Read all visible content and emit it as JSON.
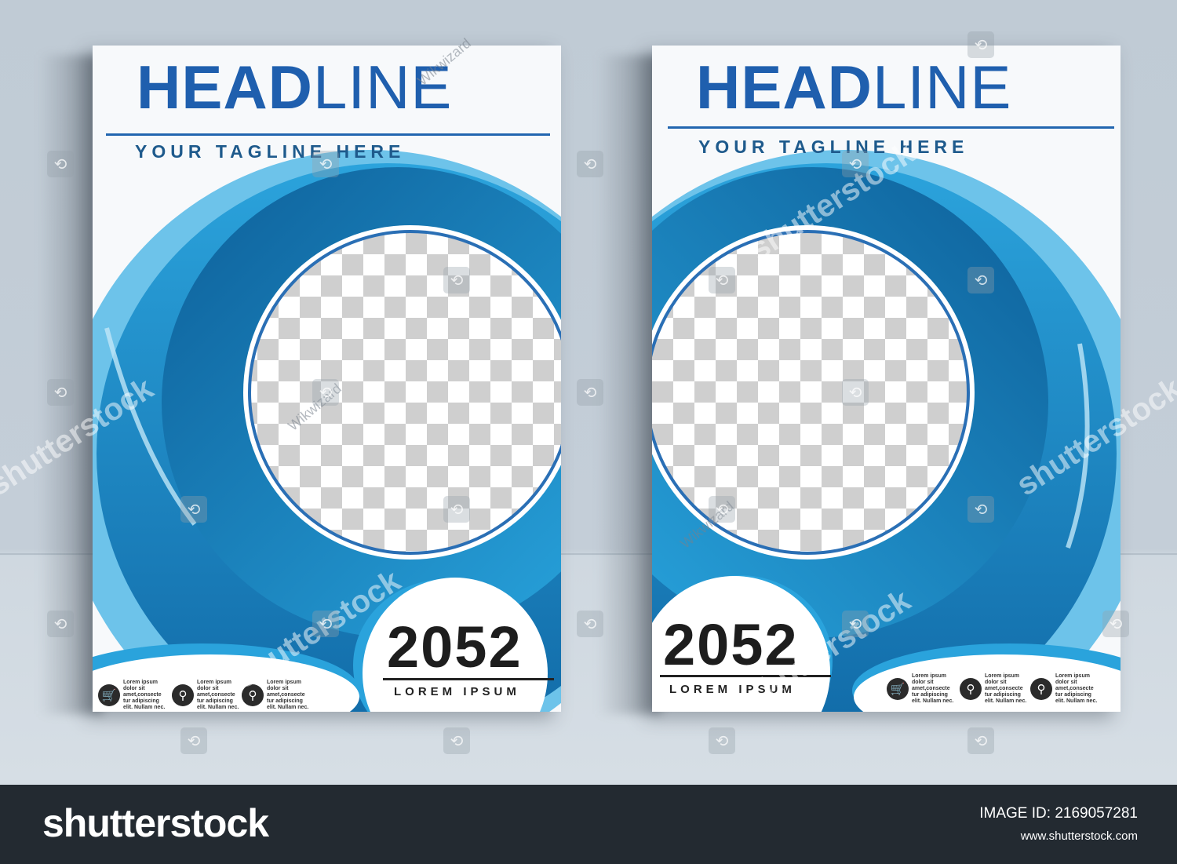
{
  "posters": [
    {
      "headline_bold": "HEAD",
      "headline_light": "LINE",
      "tagline": "YOUR TAGLINE HERE",
      "year": "2052",
      "subtitle": "LOREM IPSUM",
      "contacts": [
        {
          "icon": "cart-icon",
          "glyph": "🛒",
          "text": "Lorem ipsum dolor sit amet,consecte tur adipiscing elit. Nullam nec."
        },
        {
          "icon": "location-pin-icon",
          "glyph": "⚲",
          "text": "Lorem ipsum dolor sit amet,consecte tur adipiscing elit. Nullam nec."
        },
        {
          "icon": "search-icon",
          "glyph": "⚲",
          "text": "Lorem ipsum dolor sit amet,consecte tur adipiscing elit. Nullam nec."
        }
      ]
    },
    {
      "headline_bold": "HEAD",
      "headline_light": "LINE",
      "tagline": "YOUR TAGLINE HERE",
      "year": "2052",
      "subtitle": "LOREM IPSUM",
      "contacts": [
        {
          "icon": "cart-icon",
          "glyph": "🛒",
          "text": "Lorem ipsum dolor sit amet,consecte tur adipiscing elit. Nullam nec."
        },
        {
          "icon": "location-pin-icon",
          "glyph": "⚲",
          "text": "Lorem ipsum dolor sit amet,consecte tur adipiscing elit. Nullam nec."
        },
        {
          "icon": "search-icon",
          "glyph": "⚲",
          "text": "Lorem ipsum dolor sit amet,consecte tur adipiscing elit. Nullam nec."
        }
      ]
    }
  ],
  "watermarks": {
    "brand": "shutterstock",
    "author": "Wikwizard"
  },
  "footer": {
    "brand": "shutterstock",
    "image_id": "IMAGE ID: 2169057281",
    "url": "www.shutterstock.com"
  },
  "colors": {
    "headline": "#1f5fae",
    "ring_dark": "#0f6aa6",
    "ring_light": "#27a9e1",
    "footer_bg": "#232a31"
  }
}
